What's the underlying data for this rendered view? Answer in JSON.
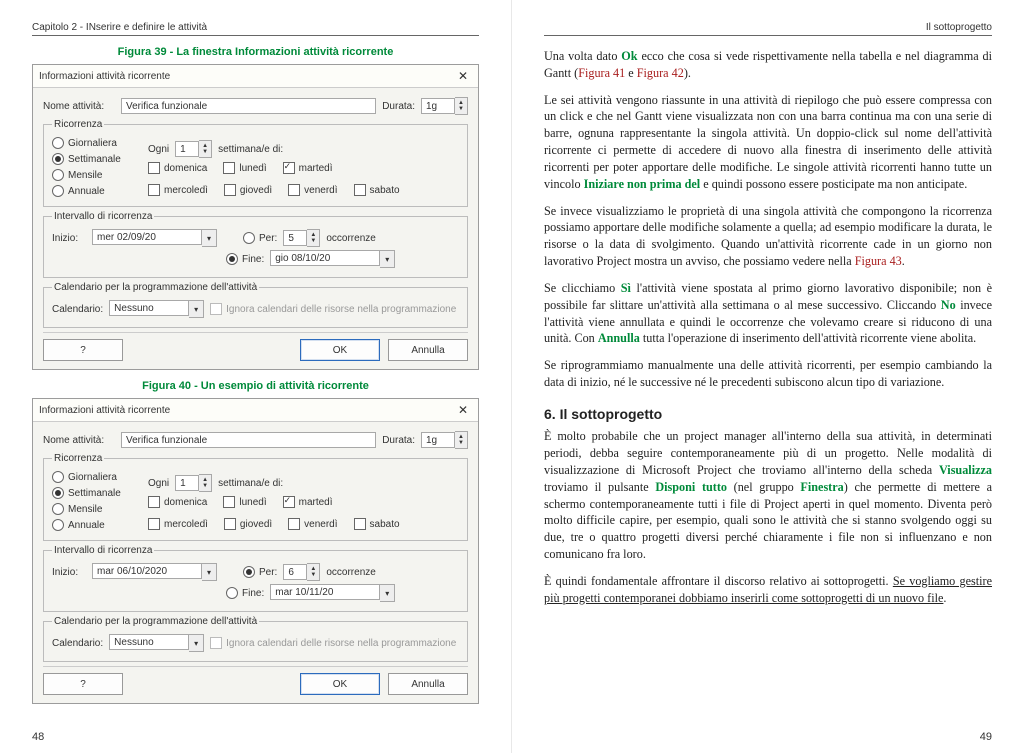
{
  "page_left": {
    "running": "Capitolo 2  -  INserire e definire le attività",
    "num": "48",
    "cap39": "Figura 39 - La finestra Informazioni attività ricorrente",
    "cap40": "Figura 40 - Un esempio di attività ricorrente"
  },
  "page_right": {
    "running": "Il sottoprogetto",
    "num": "49",
    "p1a": "Una volta dato ",
    "p1ok": "Ok",
    "p1b": " ecco che cosa si vede rispettivamente nella tabella e nel diagramma di Gantt (",
    "p1f41": "Figura 41",
    "p1and": " e ",
    "p1f42": "Figura 42",
    "p1end": ").",
    "p2a": "Le sei attività vengono riassunte in una attività di riepilogo che può essere compressa con un click e che nel Gantt viene visualizzata non con una barra continua ma con una serie di barre, ognuna rappresentante la singola attività. Un doppio-click sul nome dell'attività ricorrente ci permette di accedere di nuovo alla finestra di inserimento delle attività ricorrenti per poter apportare delle modifiche. Le singole attività ricorrenti hanno tutte un vincolo ",
    "p2link": "Iniziare non prima del",
    "p2b": " e quindi possono essere posticipate ma non anticipate.",
    "p3a": "Se invece visualizziamo le proprietà di una singola attività che compongono la ricorrenza possiamo apportare delle modifiche solamente a quella; ad esempio modificare la durata, le risorse o la data di svolgimento. Quando un'attività ricorrente cade in un giorno non lavorativo Project mostra un avviso, che possiamo vedere nella ",
    "p3link": "Figura 43",
    "p3b": ".",
    "p4a": "Se clicchiamo ",
    "p4si": "Sì",
    "p4b": " l'attività viene spostata al primo giorno lavorativo disponibile; non è possibile far slittare un'attività alla settimana o al mese successivo. Cliccando ",
    "p4no": "No",
    "p4c": " invece l'attività viene annullata e quindi le occorrenze che volevamo creare si riducono di una unità. Con ",
    "p4ann": "Annulla",
    "p4d": " tutta l'operazione di inserimento dell'attività ricorrente viene abolita.",
    "p5": "Se riprogrammiamo manualmente una delle attività ricorrenti, per esempio cambiando la data di inizio, né le successive né le precedenti subiscono alcun tipo di variazione.",
    "h6": "6. Il sottoprogetto",
    "p6a": "È molto probabile che un project manager all'interno della sua attività, in determinati periodi, debba seguire contemporaneamente più di un progetto. Nelle modalità di visualizzazione di Microsoft Project che troviamo all'interno della scheda ",
    "p6vis": "Visualizza",
    "p6b": " troviamo il pulsante ",
    "p6disp": "Disponi tutto",
    "p6c": " (nel gruppo ",
    "p6fin": "Finestra",
    "p6d": ") che permette di mettere a schermo contemporaneamente tutti i file di Project aperti in quel momento. Diventa però molto difficile capire, per esempio, quali sono le attività che si stanno svolgendo oggi su due, tre o quattro progetti diversi perché chiaramente i file non si influenzano e non comunicano fra loro.",
    "p7a": "È quindi fondamentale affrontare il discorso relativo ai sottoprogetti. ",
    "p7u": "Se vogliamo gestire più progetti contemporanei dobbiamo inserirli come sottoprogetti di un nuovo file",
    "p7b": "."
  },
  "dlg": {
    "title": "Informazioni attività ricorrente",
    "close": "✕",
    "name_lab": "Nome attività:",
    "name_val": "Verifica funzionale",
    "dur_lab": "Durata:",
    "dur_val": "1g",
    "recur_legend": "Ricorrenza",
    "radios": {
      "g": "Giornaliera",
      "s": "Settimanale",
      "m": "Mensile",
      "a": "Annuale"
    },
    "every_lab": "Ogni",
    "every_val": "1",
    "every_unit": "settimana/e di:",
    "days": {
      "dom": "domenica",
      "lun": "lunedì",
      "mar": "martedì",
      "mer": "mercoledì",
      "gio": "giovedì",
      "ven": "venerdì",
      "sab": "sabato"
    },
    "range_legend": "Intervallo di ricorrenza",
    "start_lab": "Inizio:",
    "per_lab": "Per:",
    "per_unit": "occorrenze",
    "fine_lab": "Fine:",
    "cal_legend": "Calendario per la programmazione dell'attività",
    "cal_lab": "Calendario:",
    "cal_val": "Nessuno",
    "ignore": "Ignora calendari delle risorse nella programmazione",
    "qmark": "?",
    "ok": "OK",
    "cancel": "Annulla"
  },
  "v39": {
    "start_val": "mer 02/09/20",
    "per_val": "5",
    "fine_val": "gio 08/10/20",
    "per_selected": false,
    "fine_selected": true
  },
  "v40": {
    "start_val": "mar 06/10/2020",
    "per_val": "6",
    "fine_val": "mar 10/11/20",
    "per_selected": true,
    "fine_selected": false
  }
}
